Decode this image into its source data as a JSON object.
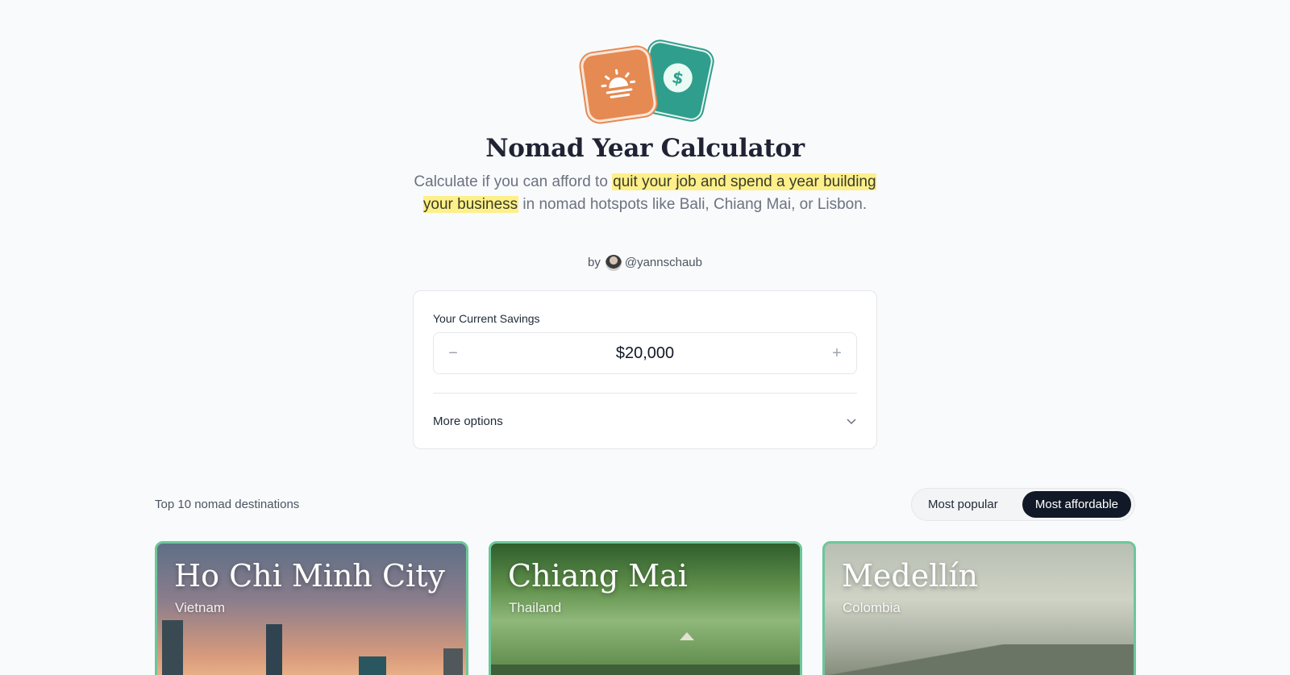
{
  "header": {
    "title": "Nomad Year Calculator",
    "subtitle_before": "Calculate if you can afford to ",
    "subtitle_highlight": "quit your job and spend a year building your business",
    "subtitle_after": " in nomad hotspots like Bali, Chiang Mai, or Lisbon.",
    "by_label": "by",
    "author": "@yannschaub"
  },
  "savings": {
    "label": "Your Current Savings",
    "value": "$20,000",
    "decrement": "−",
    "increment": "+",
    "more_options": "More options"
  },
  "destinations": {
    "section_label": "Top 10 nomad destinations",
    "sort_options": [
      "Most popular",
      "Most affordable"
    ],
    "selected_sort": "Most affordable",
    "cards": [
      {
        "name": "Ho Chi Minh City",
        "country": "Vietnam"
      },
      {
        "name": "Chiang Mai",
        "country": "Thailand"
      },
      {
        "name": "Medellín",
        "country": "Colombia"
      }
    ]
  },
  "colors": {
    "accent_orange": "#e58a52",
    "accent_green": "#2f9e8d",
    "highlight": "#fdf08a",
    "card_border": "#6cc79a",
    "dark": "#111827"
  },
  "icons": [
    "sunset-icon",
    "dollar-coin-icon",
    "minus-icon",
    "plus-icon",
    "chevron-down-icon"
  ]
}
